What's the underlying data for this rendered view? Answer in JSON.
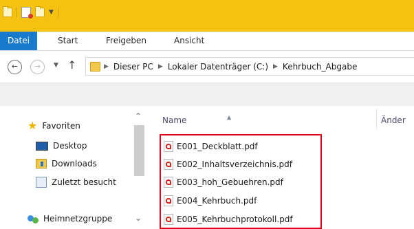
{
  "ribbon": {
    "tabs": [
      "Datei",
      "Start",
      "Freigeben",
      "Ansicht"
    ]
  },
  "address": {
    "breadcrumbs": [
      "Dieser PC",
      "Lokaler Datenträger (C:)",
      "Kehrbuch_Abgabe"
    ]
  },
  "navigation_pane": {
    "favorites_label": "Favoriten",
    "items": [
      "Desktop",
      "Downloads",
      "Zuletzt besucht"
    ],
    "homegroup_label": "Heimnetzgruppe"
  },
  "file_list": {
    "columns": [
      "Name",
      "Änder"
    ],
    "files": [
      "E001_Deckblatt.pdf",
      "E002_Inhaltsverzeichnis.pdf",
      "E003_hoh_Gebuehren.pdf",
      "E004_Kehrbuch.pdf",
      "E005_Kehrbuchprotokoll.pdf"
    ]
  },
  "colors": {
    "titlebar": "#f5c211",
    "file_tab": "#1979ca",
    "highlight_box": "#e3001b"
  }
}
